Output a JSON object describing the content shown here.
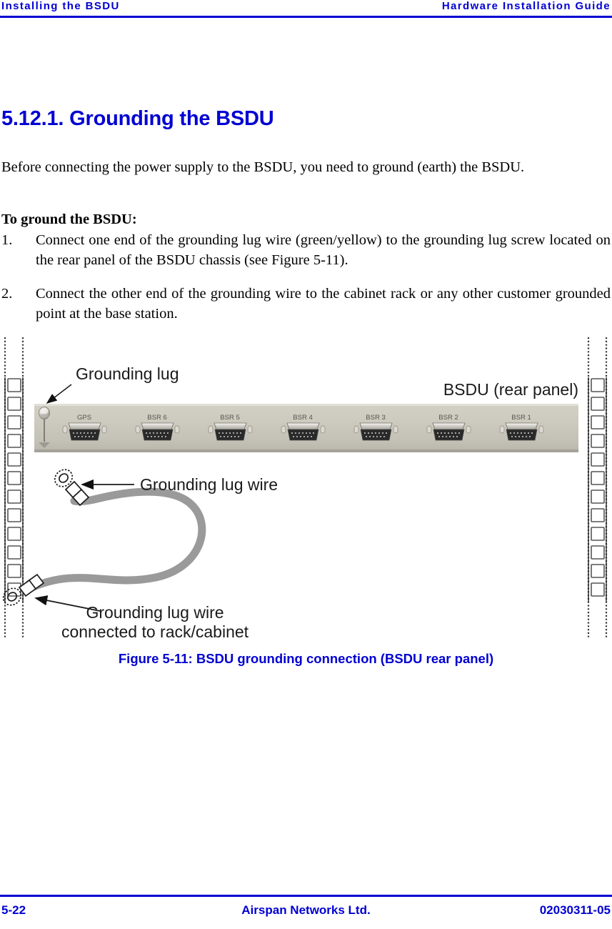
{
  "header": {
    "left": "Installing the BSDU",
    "right": "Hardware Installation Guide"
  },
  "section": {
    "heading": "5.12.1. Grounding the BSDU",
    "intro": "Before connecting the power supply to the BSDU, you need to ground (earth) the BSDU.",
    "lead_in": "To ground the BSDU:",
    "steps": [
      {
        "marker": "1.",
        "text": "Connect one end of the grounding lug wire (green/yellow) to the grounding lug screw located on the rear panel of the BSDU chassis (see Figure 5-11)."
      },
      {
        "marker": "2.",
        "text": "Connect the other end of the grounding wire to the cabinet rack or any other customer grounded point at the base station."
      }
    ]
  },
  "figure": {
    "caption": "Figure 5-11:  BSDU grounding connection (BSDU rear panel)",
    "callouts": {
      "grounding_lug": "Grounding lug",
      "rear_panel": "BSDU (rear panel)",
      "lug_wire": "Grounding lug wire",
      "lug_wire_rack_line1": "Grounding lug wire",
      "lug_wire_rack_line2": "connected to rack/cabinet"
    },
    "panel_ports": [
      "GPS",
      "BSR 6",
      "BSR 5",
      "BSR 4",
      "BSR 3",
      "BSR 2",
      "BSR 1"
    ]
  },
  "footer": {
    "page_number": "5-22",
    "company": "Airspan Networks Ltd.",
    "document_number": "02030311-05"
  },
  "colors": {
    "accent_blue": "#0000d2",
    "panel_face": "#c9c7bb",
    "wire_gray": "#9a9a9a"
  }
}
